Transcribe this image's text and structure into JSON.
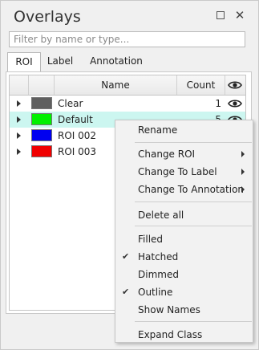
{
  "panel": {
    "title": "Overlays",
    "restore_icon": "restore-icon",
    "close_glyph": "✕"
  },
  "filter": {
    "placeholder": "Filter by name or type...",
    "value": ""
  },
  "tabs": [
    {
      "label": "ROI",
      "active": true
    },
    {
      "label": "Label",
      "active": false
    },
    {
      "label": "Annotation",
      "active": false
    }
  ],
  "table": {
    "headers": {
      "name": "Name",
      "count": "Count",
      "visibility_icon": "eye-icon"
    },
    "rows": [
      {
        "name": "Clear",
        "color": "#5f5f5f",
        "count": "1",
        "selected": false,
        "visible_icon": "eye-icon"
      },
      {
        "name": "Default",
        "color": "#00f000",
        "count": "5",
        "selected": true,
        "visible_icon": "eye-icon"
      },
      {
        "name": "ROI 002",
        "color": "#0000f0",
        "count": "",
        "selected": false,
        "visible_icon": ""
      },
      {
        "name": "ROI 003",
        "color": "#f00000",
        "count": "",
        "selected": false,
        "visible_icon": ""
      }
    ]
  },
  "context_menu": {
    "items": [
      {
        "label": "Rename",
        "submenu": false,
        "checked": false
      },
      {
        "label": "Change ROI",
        "submenu": true,
        "checked": false
      },
      {
        "label": "Change To Label",
        "submenu": true,
        "checked": false
      },
      {
        "label": "Change To Annotation",
        "submenu": true,
        "checked": false
      },
      {
        "label": "Delete all",
        "submenu": false,
        "checked": false
      },
      {
        "label": "Filled",
        "submenu": false,
        "checked": false
      },
      {
        "label": "Hatched",
        "submenu": false,
        "checked": true
      },
      {
        "label": "Dimmed",
        "submenu": false,
        "checked": false
      },
      {
        "label": "Outline",
        "submenu": false,
        "checked": true
      },
      {
        "label": "Show Names",
        "submenu": false,
        "checked": false
      },
      {
        "label": "Expand Class",
        "submenu": false,
        "checked": false
      }
    ]
  },
  "colors": {
    "selected_row": "#ccf6f0",
    "menu_background": "#f2f2f2"
  }
}
